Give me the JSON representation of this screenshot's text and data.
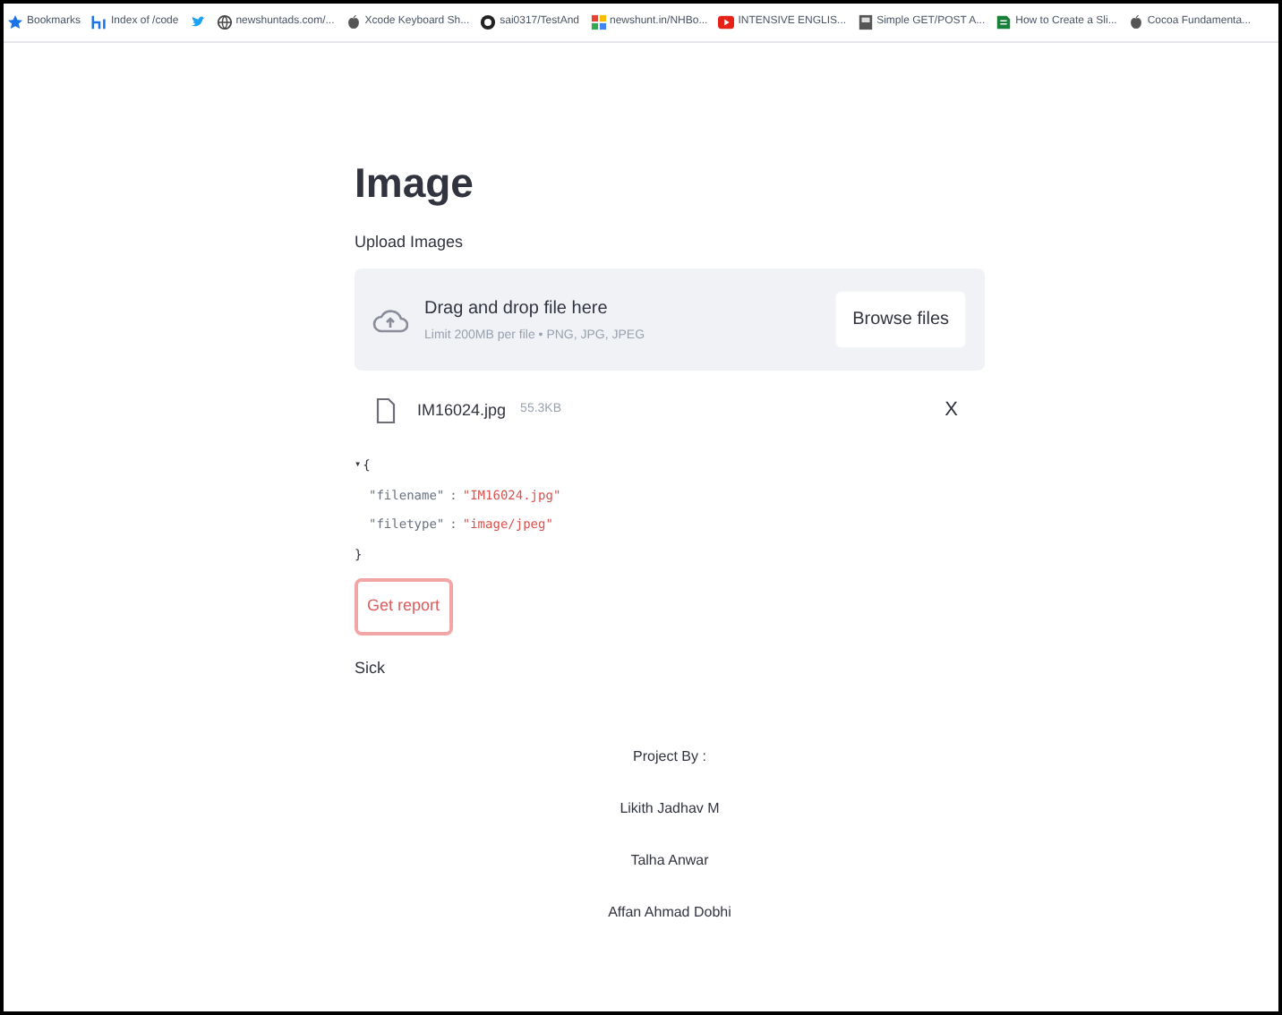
{
  "bookmarks_bar": [
    {
      "kind": "star",
      "label": "Bookmarks"
    },
    {
      "kind": "index",
      "label": "Index of /code"
    },
    {
      "kind": "bird"
    },
    {
      "kind": "globe",
      "label": "newshuntads.com/..."
    },
    {
      "kind": "apple",
      "label": "Xcode Keyboard Sh..."
    },
    {
      "kind": "github",
      "label": "sai0317/TestAnd"
    },
    {
      "kind": "grid",
      "label": "newshunt.in/NHBo..."
    },
    {
      "kind": "play",
      "label": "INTENSIVE ENGLIS..."
    },
    {
      "kind": "doc",
      "label": "Simple GET/POST A..."
    },
    {
      "kind": "page",
      "label": "How to Create a Sli..."
    },
    {
      "kind": "apple",
      "label": "Cocoa Fundamenta..."
    }
  ],
  "heading": "Image",
  "uploader": {
    "label": "Upload Images",
    "drop_text": "Drag and drop file here",
    "limit": "Limit 200MB per file • PNG, JPG, JPEG",
    "browse_button": "Browse files"
  },
  "file": {
    "name": "IM16024.jpg",
    "size": "55.3KB",
    "remove": "X"
  },
  "json_view": {
    "toggle": "▾",
    "open": "{",
    "close": "}",
    "entries": [
      {
        "key": "\"filename\"",
        "sep": ":",
        "value": "\"IM16024.jpg\""
      },
      {
        "key": "\"filetype\"",
        "sep": ":",
        "value": "\"image/jpeg\""
      }
    ]
  },
  "report_button": "Get report",
  "result": "Sick",
  "footer": [
    "Project By :",
    "Likith Jadhav M",
    "Talha Anwar",
    "Affan Ahmad Dobhi"
  ]
}
